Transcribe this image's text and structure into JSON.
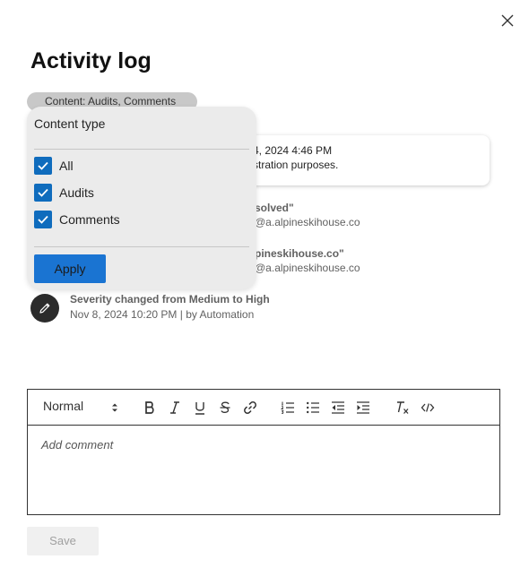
{
  "panel": {
    "title": "Activity log",
    "close_icon": "close-icon"
  },
  "filter": {
    "chip_label": "Content: Audits, Comments",
    "dropdown": {
      "header": "Content type",
      "options": [
        {
          "label": "All",
          "checked": true
        },
        {
          "label": "Audits",
          "checked": true
        },
        {
          "label": "Comments",
          "checked": true
        }
      ],
      "apply_label": "Apply"
    }
  },
  "activity": {
    "comment_card": {
      "time_partial": "4, 2024 4:46 PM",
      "text_partial": "stration purposes."
    },
    "hidden_entries": [
      {
        "title_partial": "solved\"",
        "sub_partial": "@a.alpineskihouse.co"
      },
      {
        "title_partial": "pineskihouse.co\"",
        "sub_partial": "@a.alpineskihouse.co"
      }
    ],
    "entry": {
      "icon": "pencil-icon",
      "title": "Severity changed from Medium to High",
      "subtitle": "Nov 8, 2024 10:20 PM | by Automation"
    }
  },
  "editor": {
    "format_select": "Normal",
    "toolbar_icons": [
      "bold-icon",
      "italic-icon",
      "underline-icon",
      "strikethrough-icon",
      "link-icon",
      "ordered-list-icon",
      "bullet-list-icon",
      "outdent-icon",
      "indent-icon",
      "clear-format-icon",
      "code-icon"
    ],
    "placeholder": "Add comment"
  },
  "actions": {
    "save_label": "Save"
  },
  "colors": {
    "accent": "#0f6cbd",
    "apply_button": "#1a74d2",
    "chip": "#c8c8c8",
    "dropdown_bg": "#ebebeb"
  }
}
